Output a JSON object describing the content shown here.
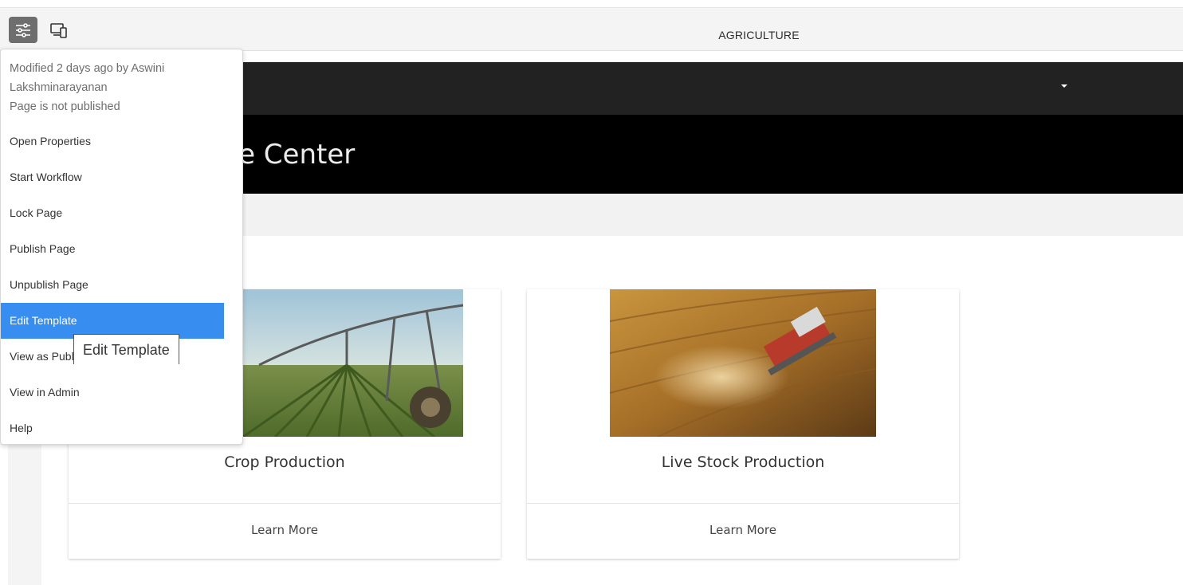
{
  "toolbar": {
    "settings_icon": "sliders-icon",
    "emulator_icon": "device-emulator-icon",
    "page_title": "AGRICULTURE"
  },
  "site": {
    "hero_title_visible": "edge Center",
    "cards": [
      {
        "title": "Crop Production",
        "cta": "Learn More",
        "image": "irrigation-field-image"
      },
      {
        "title": "Live Stock Production",
        "cta": "Learn More",
        "image": "combine-harvester-image"
      }
    ]
  },
  "page_info_menu": {
    "modified_line1": "Modified 2 days ago by Aswini",
    "modified_line2": "Lakshminarayanan",
    "publish_status": "Page is not published",
    "items": [
      {
        "label": "Open Properties"
      },
      {
        "label": "Start Workflow"
      },
      {
        "label": "Lock Page"
      },
      {
        "label": "Publish Page"
      },
      {
        "label": "Unpublish Page"
      },
      {
        "label": "Edit Template",
        "active": true
      },
      {
        "label": "View as Publis"
      },
      {
        "label": "View in Admin"
      },
      {
        "label": "Help"
      }
    ],
    "tooltip": "Edit Template"
  },
  "colors": {
    "active_item": "#378ef0",
    "nav_bar": "#222222",
    "hero": "#000000"
  }
}
